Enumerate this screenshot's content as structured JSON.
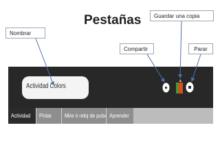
{
  "slide": {
    "title": "Pestañas"
  },
  "callouts": {
    "guardar": "Guardar una copia",
    "nombrar": "Nombrar",
    "compartir": "Compartir",
    "parar": "Parar"
  },
  "toolbar": {
    "activity_name": "Actividad Colors",
    "colors": {
      "background": "#282828",
      "field": "#f4f4f4",
      "keep_icon": "#d2521e",
      "keep_accent": "#3b9e3b"
    }
  },
  "tabs": [
    {
      "label": "Actividad",
      "active": true
    },
    {
      "label": "Pintar",
      "active": false
    },
    {
      "label": "Mire ó reloj de pulsera",
      "active": false
    },
    {
      "label": "Aprender",
      "active": false
    }
  ]
}
